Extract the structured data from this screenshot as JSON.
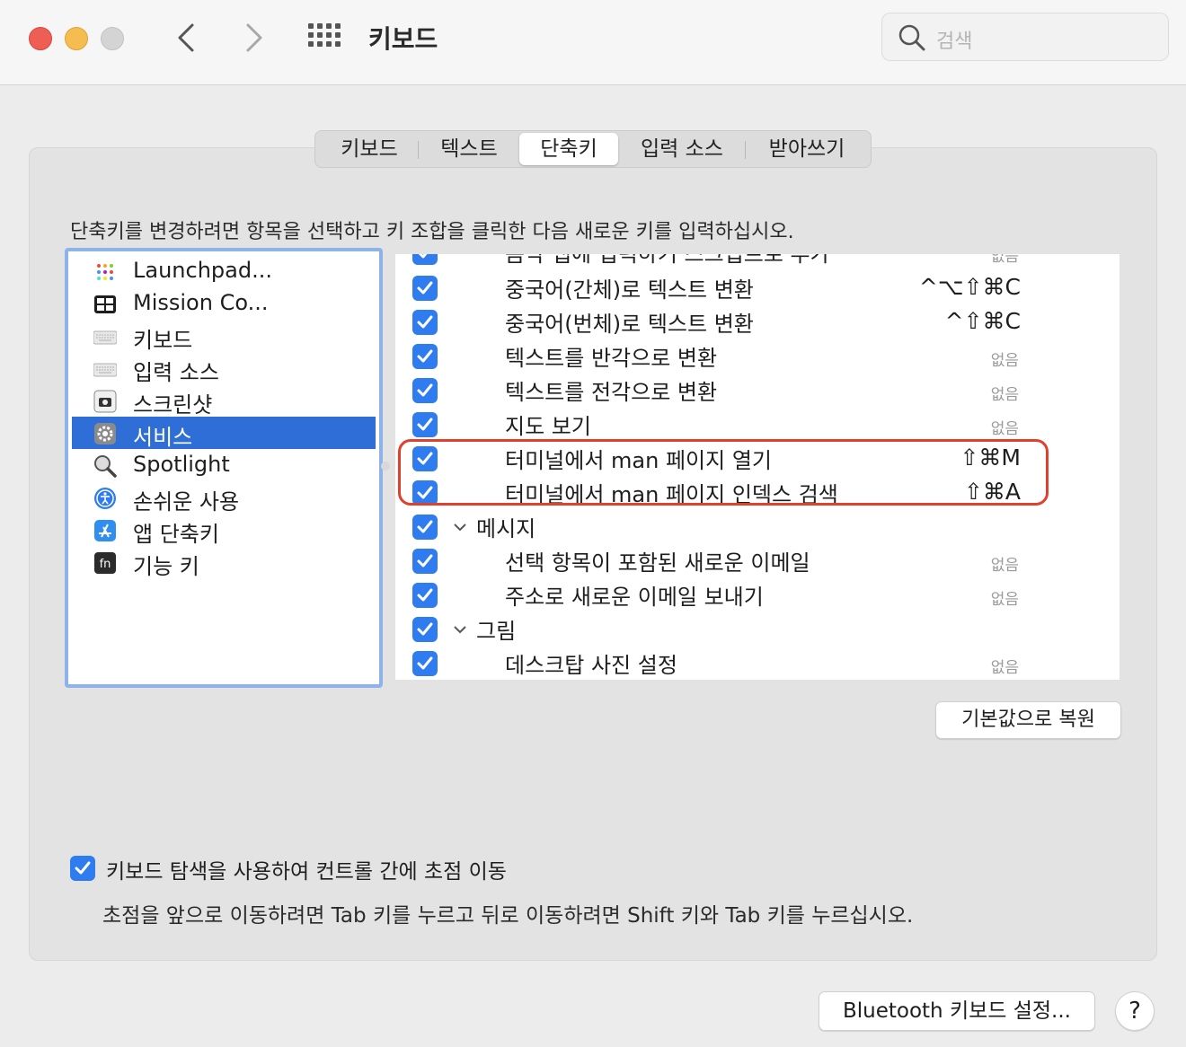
{
  "window": {
    "title": "키보드"
  },
  "search": {
    "placeholder": "검색"
  },
  "tabs": [
    "키보드",
    "텍스트",
    "단축키",
    "입력 소스",
    "받아쓰기"
  ],
  "active_tab_index": 2,
  "instruction": "단축키를 변경하려면 항목을 선택하고 키 조합을 클릭한 다음 새로운 키를 입력하십시오.",
  "categories": [
    {
      "label": "Launchpad...",
      "icon": "launchpad-icon"
    },
    {
      "label": "Mission Co...",
      "icon": "mission-control-icon"
    },
    {
      "label": "키보드",
      "icon": "keyboard-icon"
    },
    {
      "label": "입력 소스",
      "icon": "input-source-icon"
    },
    {
      "label": "스크린샷",
      "icon": "screenshot-icon"
    },
    {
      "label": "서비스",
      "icon": "gear-icon",
      "selected": true
    },
    {
      "label": "Spotlight",
      "icon": "spotlight-icon"
    },
    {
      "label": "손쉬운 사용",
      "icon": "accessibility-icon"
    },
    {
      "label": "앱 단축키",
      "icon": "app-store-icon"
    },
    {
      "label": "기능 키",
      "icon": "fn-key-icon"
    }
  ],
  "shortcuts": [
    {
      "label": "음악 탭에 입력하기 스크립트로 추가",
      "shortcut": "없음",
      "checked": true,
      "partial": true
    },
    {
      "label": "중국어(간체)로 텍스트 변환",
      "shortcut": "^⌥⇧⌘C",
      "checked": true
    },
    {
      "label": "중국어(번체)로 텍스트 변환",
      "shortcut": "^⇧⌘C",
      "checked": true
    },
    {
      "label": "텍스트를 반각으로 변환",
      "shortcut": "없음",
      "checked": true
    },
    {
      "label": "텍스트를 전각으로 변환",
      "shortcut": "없음",
      "checked": true
    },
    {
      "label": "지도 보기",
      "shortcut": "없음",
      "checked": true
    },
    {
      "label": "터미널에서 man 페이지 열기",
      "shortcut": "⇧⌘M",
      "checked": true,
      "highlighted": true
    },
    {
      "label": "터미널에서 man 페이지 인덱스 검색",
      "shortcut": "⇧⌘A",
      "checked": true,
      "highlighted": true
    },
    {
      "group": "메시지",
      "checked": true
    },
    {
      "label": "선택 항목이 포함된 새로운 이메일",
      "shortcut": "없음",
      "checked": true
    },
    {
      "label": "주소로 새로운 이메일 보내기",
      "shortcut": "없음",
      "checked": true
    },
    {
      "group": "그림",
      "checked": true
    },
    {
      "label": "데스크탑 사진 설정",
      "shortcut": "없음",
      "checked": true
    }
  ],
  "restore_button": "기본값으로 복원",
  "keyboard_nav": {
    "checked": true,
    "label": "키보드 탐색을 사용하여 컨트롤 간에 초점 이동",
    "description": "초점을 앞으로 이동하려면 Tab 키를 누르고 뒤로 이동하려면 Shift 키와 Tab 키를 누르십시오."
  },
  "bluetooth_button": "Bluetooth 키보드 설정...",
  "help_button": "?",
  "colors": {
    "accent": "#2f7cf0",
    "selection": "#2e6ed6",
    "highlight": "#e0412c"
  }
}
